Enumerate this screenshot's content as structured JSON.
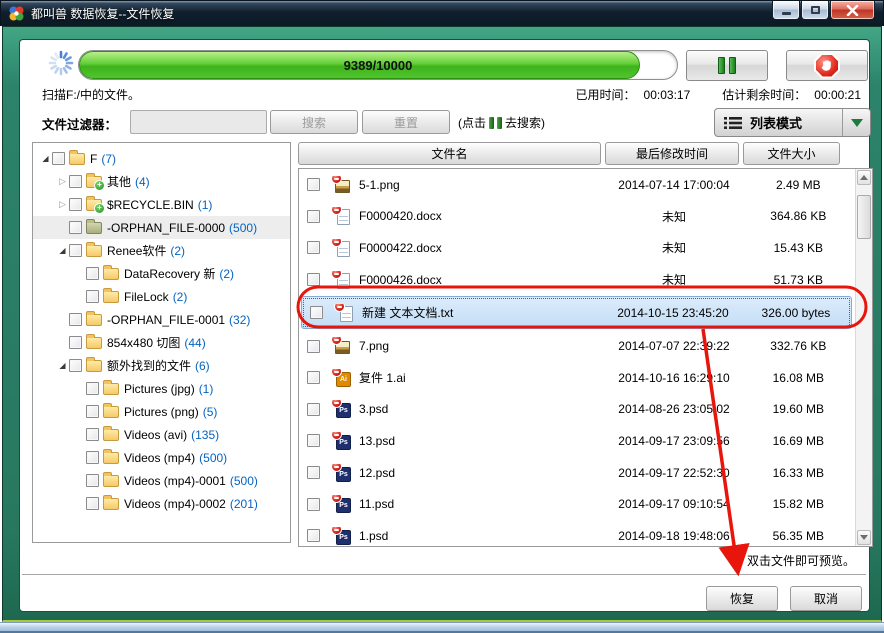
{
  "window": {
    "title": "都叫兽 数据恢复--文件恢复"
  },
  "progress": {
    "value_label": "9389/10000",
    "percent": 93.89,
    "status": "扫描F:/中的文件。",
    "elapsed_label": "已用时间：",
    "elapsed_value": "00:03:17",
    "remaining_label": "估计剩余时间：",
    "remaining_value": "00:00:21"
  },
  "filter": {
    "label": "文件过滤器：",
    "input_value": "",
    "search_label": "搜索",
    "reset_label": "重置",
    "hint_prefix": "(点击",
    "hint_suffix": "去搜索)"
  },
  "toolbar": {
    "view_mode_label": "列表模式"
  },
  "tree": {
    "items": [
      {
        "level": 0,
        "expander": "open",
        "label": "F",
        "count": "7"
      },
      {
        "level": 1,
        "expander": "closed",
        "badge": "add",
        "label": "其他",
        "count": "4"
      },
      {
        "level": 1,
        "expander": "closed",
        "badge": "add",
        "label": "$RECYCLE.BIN",
        "count": "1"
      },
      {
        "level": 1,
        "expander": "none",
        "folder": "olive",
        "label": "-ORPHAN_FILE-0000",
        "count": "500",
        "selected": true
      },
      {
        "level": 1,
        "expander": "open",
        "label": "Renee软件",
        "count": "2"
      },
      {
        "level": 2,
        "expander": "none",
        "label": "DataRecovery 新",
        "count": "2"
      },
      {
        "level": 2,
        "expander": "none",
        "label": "FileLock",
        "count": "2"
      },
      {
        "level": 1,
        "expander": "none",
        "label": "-ORPHAN_FILE-0001",
        "count": "32"
      },
      {
        "level": 1,
        "expander": "none",
        "label": "854x480 切图",
        "count": "44"
      },
      {
        "level": 1,
        "expander": "open",
        "label": "额外找到的文件",
        "count": "6"
      },
      {
        "level": 2,
        "expander": "none",
        "label": "Pictures (jpg)",
        "count": "1"
      },
      {
        "level": 2,
        "expander": "none",
        "label": "Pictures (png)",
        "count": "5"
      },
      {
        "level": 2,
        "expander": "none",
        "label": "Videos (avi)",
        "count": "135"
      },
      {
        "level": 2,
        "expander": "none",
        "label": "Videos (mp4)",
        "count": "500"
      },
      {
        "level": 2,
        "expander": "none",
        "label": "Videos (mp4)-0001",
        "count": "500"
      },
      {
        "level": 2,
        "expander": "none",
        "label": "Videos (mp4)-0002",
        "count": "201"
      }
    ]
  },
  "table": {
    "headers": [
      "文件名",
      "最后修改时间",
      "文件大小"
    ],
    "rows": [
      {
        "name": "5-1.png",
        "icon": "image",
        "modified": "2014-07-14 17:00:04",
        "size": "2.49 MB"
      },
      {
        "name": "F0000420.docx",
        "icon": "doc",
        "modified": "未知",
        "size": "364.86 KB"
      },
      {
        "name": "F0000422.docx",
        "icon": "doc",
        "modified": "未知",
        "size": "15.43 KB"
      },
      {
        "name": "F0000426.docx",
        "icon": "doc",
        "modified": "未知",
        "size": "51.73 KB"
      },
      {
        "name": "新建 文本文档.txt",
        "icon": "doc",
        "modified": "2014-10-15 23:45:20",
        "size": "326.00 bytes",
        "selected": true
      },
      {
        "name": "7.png",
        "icon": "image",
        "modified": "2014-07-07 22:39:22",
        "size": "332.76 KB"
      },
      {
        "name": "复件 1.ai",
        "icon": "ai",
        "modified": "2014-10-16 16:29:10",
        "size": "16.08 MB"
      },
      {
        "name": "3.psd",
        "icon": "psd",
        "modified": "2014-08-26 23:05:02",
        "size": "19.60 MB"
      },
      {
        "name": "13.psd",
        "icon": "psd",
        "modified": "2014-09-17 23:09:56",
        "size": "16.69 MB"
      },
      {
        "name": "12.psd",
        "icon": "psd",
        "modified": "2014-09-17 22:52:30",
        "size": "16.33 MB"
      },
      {
        "name": "11.psd",
        "icon": "psd",
        "modified": "2014-09-17 09:10:54",
        "size": "15.82 MB"
      },
      {
        "name": "1.psd",
        "icon": "psd",
        "modified": "2014-09-18 19:48:06",
        "size": "56.35 MB"
      }
    ]
  },
  "footer": {
    "tip": "双击文件即可预览。",
    "recover_label": "恢复",
    "cancel_label": "取消"
  },
  "colors": {
    "frame_green": "#27785f",
    "progress_green": "#3eb31c",
    "count_blue": "#0563c1",
    "annotation_red": "#e8150d",
    "selection_blue": "#c3ddf5"
  }
}
